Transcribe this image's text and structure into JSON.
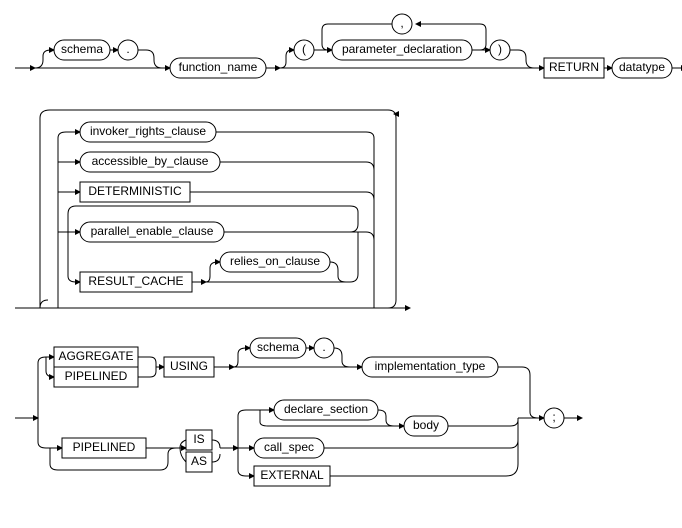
{
  "diagram": {
    "type": "railroad-syntax-diagram",
    "language": "PL/SQL",
    "rule": "function_definition",
    "sections": [
      {
        "id": "header",
        "sequence": [
          {
            "optional": [
              {
                "nonterminal": "schema"
              },
              {
                "terminal": "."
              }
            ]
          },
          {
            "nonterminal": "function_name"
          },
          {
            "optional": [
              {
                "terminal": "("
              },
              {
                "repeat": {
                  "item": {
                    "nonterminal": "parameter_declaration"
                  },
                  "separator": {
                    "terminal": ","
                  }
                }
              },
              {
                "terminal": ")"
              }
            ]
          },
          {
            "keyword": "RETURN"
          },
          {
            "nonterminal": "datatype"
          }
        ]
      },
      {
        "id": "clauses",
        "repeat_zero_or_more": {
          "alternatives": [
            {
              "nonterminal": "invoker_rights_clause"
            },
            {
              "nonterminal": "accessible_by_clause"
            },
            {
              "keyword": "DETERMINISTIC"
            },
            {
              "repeat_one_or_more": {
                "alternatives": [
                  {
                    "nonterminal": "parallel_enable_clause"
                  },
                  {
                    "sequence": [
                      {
                        "keyword": "RESULT_CACHE"
                      },
                      {
                        "optional": [
                          {
                            "nonterminal": "relies_on_clause"
                          }
                        ]
                      }
                    ]
                  }
                ]
              }
            }
          ]
        }
      },
      {
        "id": "body",
        "sequence": [
          {
            "alternatives": [
              {
                "sequence": [
                  {
                    "alternatives": [
                      {
                        "keyword": "AGGREGATE"
                      },
                      {
                        "keyword": "PIPELINED"
                      }
                    ]
                  },
                  {
                    "keyword": "USING"
                  },
                  {
                    "optional": [
                      {
                        "nonterminal": "schema"
                      },
                      {
                        "terminal": "."
                      }
                    ]
                  },
                  {
                    "nonterminal": "implementation_type"
                  }
                ]
              },
              {
                "sequence": [
                  {
                    "optional": [
                      {
                        "keyword": "PIPELINED"
                      }
                    ]
                  },
                  {
                    "alternatives": [
                      {
                        "keyword": "IS"
                      },
                      {
                        "keyword": "AS"
                      }
                    ]
                  },
                  {
                    "alternatives": [
                      {
                        "sequence": [
                          {
                            "optional": [
                              {
                                "nonterminal": "declare_section"
                              }
                            ]
                          },
                          {
                            "nonterminal": "body"
                          }
                        ]
                      },
                      {
                        "nonterminal": "call_spec"
                      },
                      {
                        "keyword": "EXTERNAL"
                      }
                    ]
                  }
                ]
              }
            ]
          },
          {
            "terminal": ";"
          }
        ]
      }
    ]
  },
  "labels": {
    "schema": "schema",
    "dot": ".",
    "function_name": "function_name",
    "lparen": "(",
    "rparen": ")",
    "comma": ",",
    "parameter_declaration": "parameter_declaration",
    "RETURN": "RETURN",
    "datatype": "datatype",
    "invoker_rights_clause": "invoker_rights_clause",
    "accessible_by_clause": "accessible_by_clause",
    "DETERMINISTIC": "DETERMINISTIC",
    "parallel_enable_clause": "parallel_enable_clause",
    "RESULT_CACHE": "RESULT_CACHE",
    "relies_on_clause": "relies_on_clause",
    "AGGREGATE": "AGGREGATE",
    "PIPELINED": "PIPELINED",
    "USING": "USING",
    "implementation_type": "implementation_type",
    "IS": "IS",
    "AS": "AS",
    "declare_section": "declare_section",
    "body": "body",
    "call_spec": "call_spec",
    "EXTERNAL": "EXTERNAL",
    "semicolon": ";"
  }
}
